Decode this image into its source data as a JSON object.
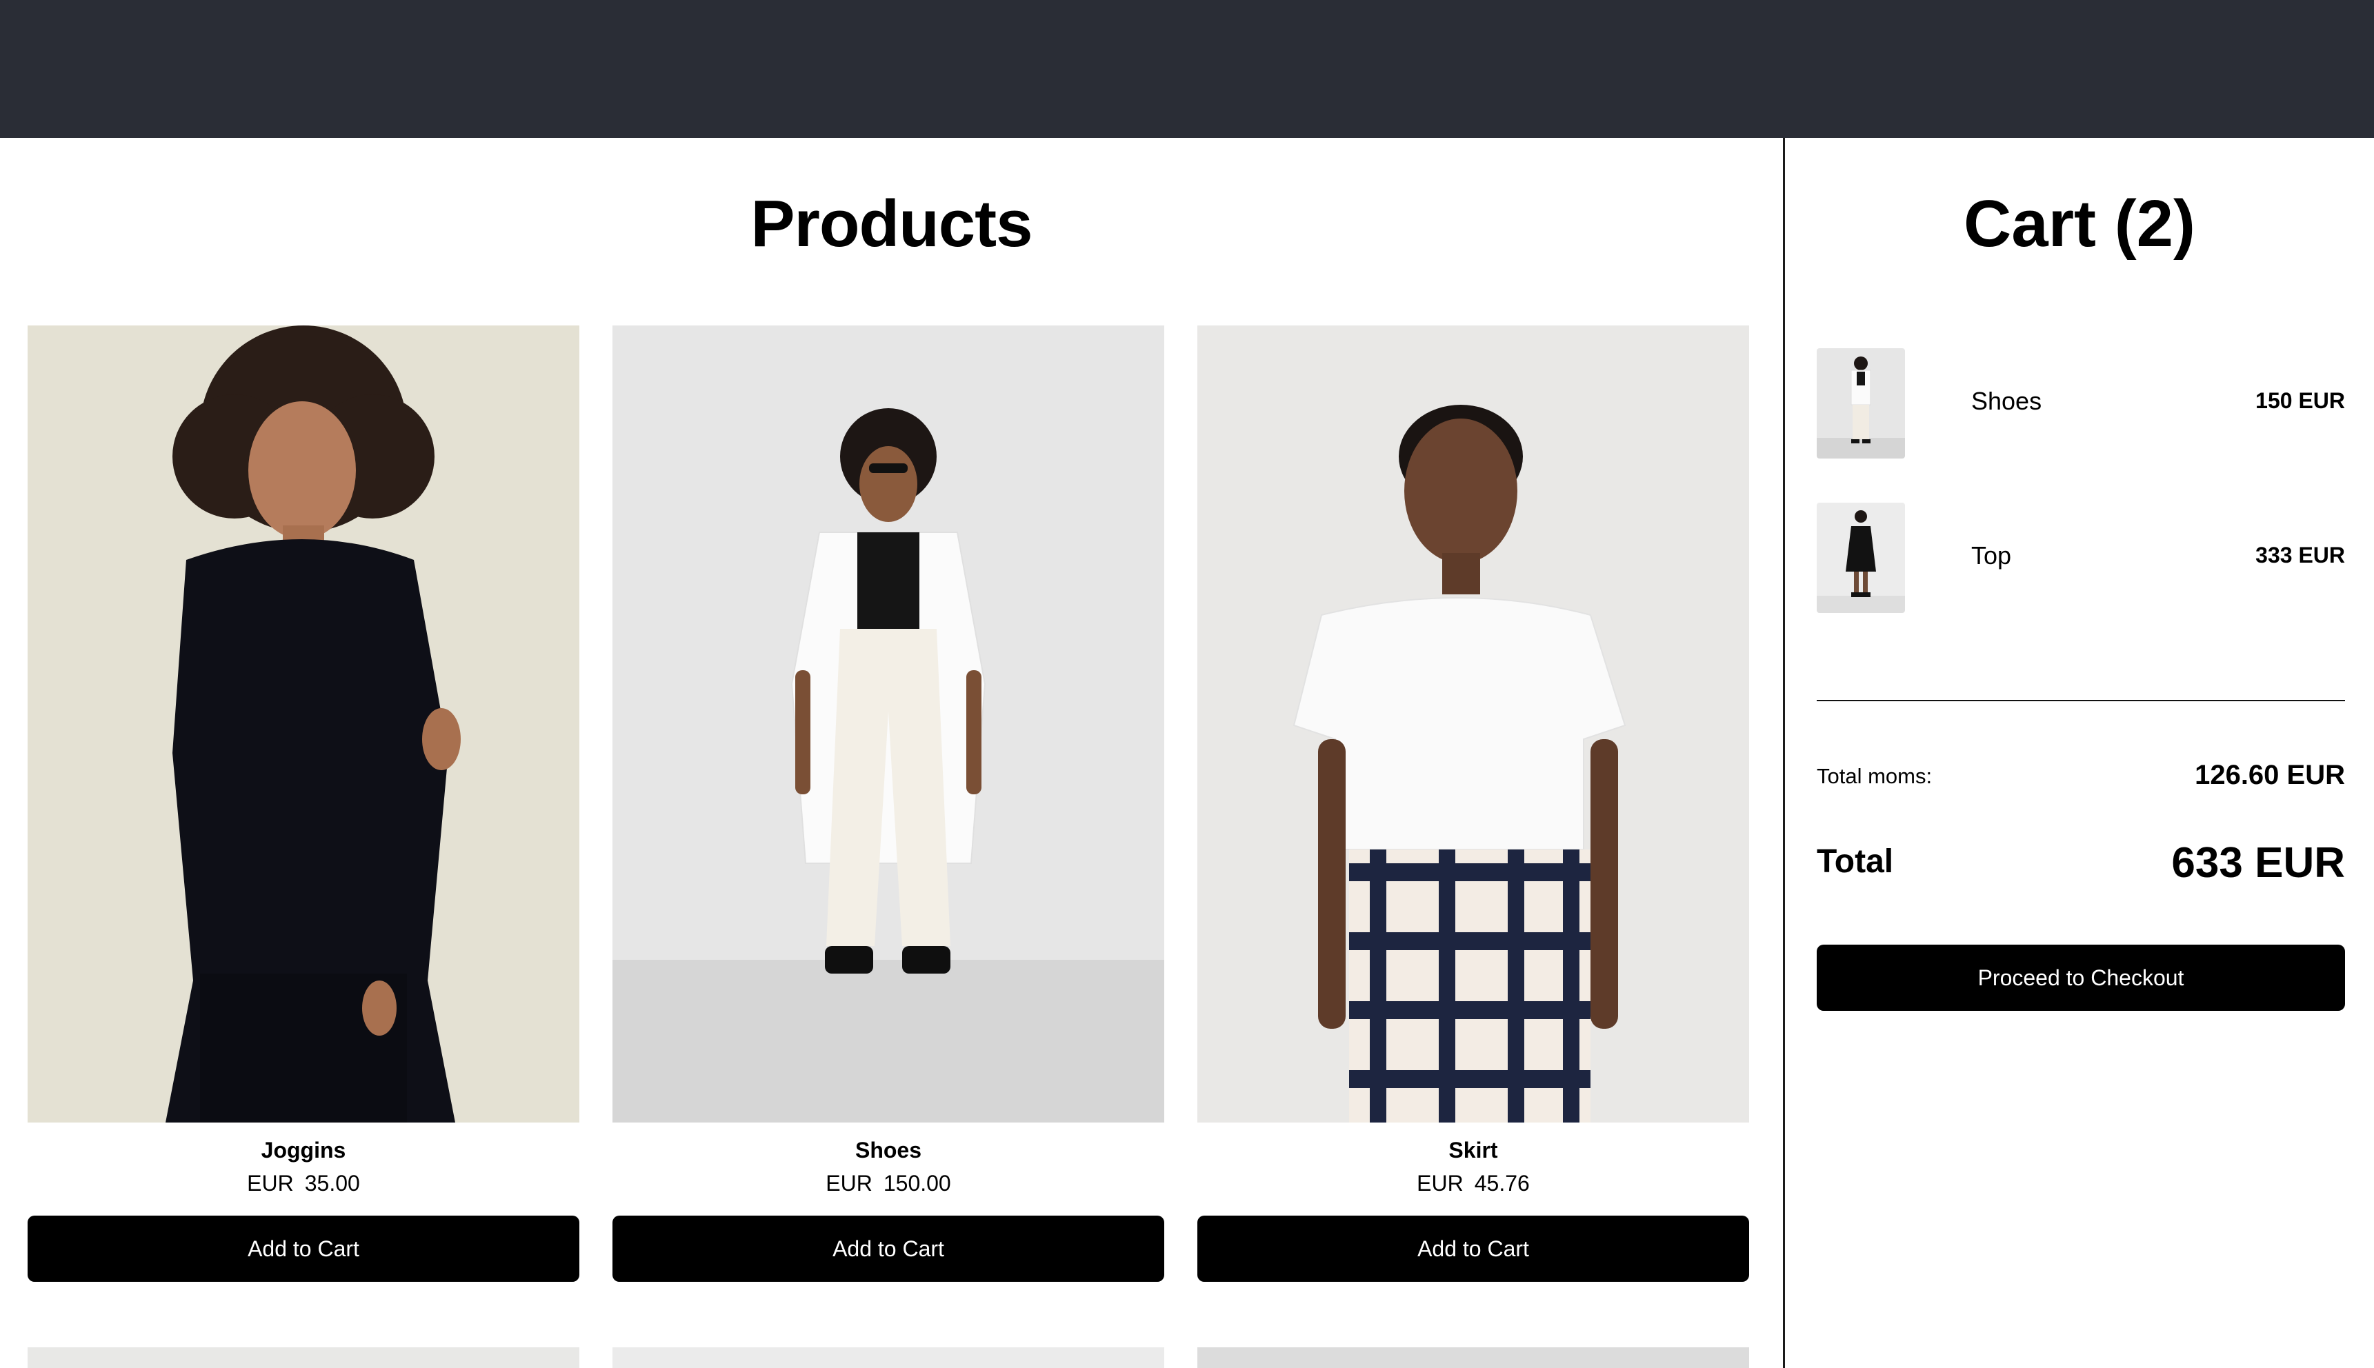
{
  "colors": {
    "topbar": "#2a2d36",
    "button_bg": "#000000",
    "button_text": "#ffffff"
  },
  "products": {
    "title": "Products",
    "items": [
      {
        "name": "Joggins",
        "currency": "EUR",
        "price": "35.00",
        "button_label": "Add to Cart",
        "image": "model-black-hoodie"
      },
      {
        "name": "Shoes",
        "currency": "EUR",
        "price": "150.00",
        "button_label": "Add to Cart",
        "image": "model-white-shirt-sunglasses"
      },
      {
        "name": "Skirt",
        "currency": "EUR",
        "price": "45.76",
        "button_label": "Add to Cart",
        "image": "model-white-tee-plaid"
      }
    ]
  },
  "cart": {
    "title": "Cart (2)",
    "items": [
      {
        "name": "Shoes",
        "price": "150 EUR",
        "image": "thumb-white-outfit"
      },
      {
        "name": "Top",
        "price": "333 EUR",
        "image": "thumb-black-dress"
      }
    ],
    "moms_label": "Total moms:",
    "moms_value": "126.60 EUR",
    "total_label": "Total",
    "total_value": "633 EUR",
    "checkout_label": "Proceed to Checkout"
  }
}
